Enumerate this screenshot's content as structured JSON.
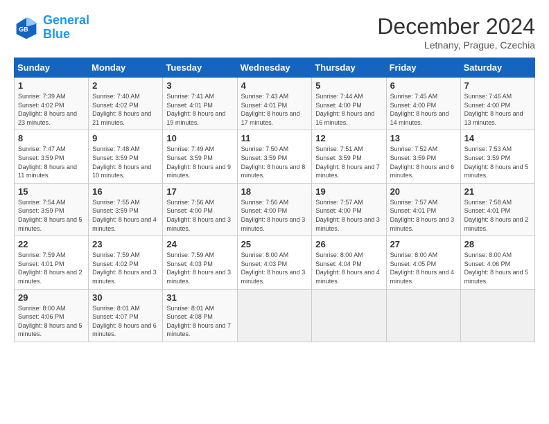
{
  "header": {
    "logo_line1": "General",
    "logo_line2": "Blue",
    "month": "December 2024",
    "location": "Letnany, Prague, Czechia"
  },
  "days_of_week": [
    "Sunday",
    "Monday",
    "Tuesday",
    "Wednesday",
    "Thursday",
    "Friday",
    "Saturday"
  ],
  "weeks": [
    [
      {
        "day": "1",
        "detail": "Sunrise: 7:39 AM\nSunset: 4:02 PM\nDaylight: 8 hours and 23 minutes."
      },
      {
        "day": "2",
        "detail": "Sunrise: 7:40 AM\nSunset: 4:02 PM\nDaylight: 8 hours and 21 minutes."
      },
      {
        "day": "3",
        "detail": "Sunrise: 7:41 AM\nSunset: 4:01 PM\nDaylight: 8 hours and 19 minutes."
      },
      {
        "day": "4",
        "detail": "Sunrise: 7:43 AM\nSunset: 4:01 PM\nDaylight: 8 hours and 17 minutes."
      },
      {
        "day": "5",
        "detail": "Sunrise: 7:44 AM\nSunset: 4:00 PM\nDaylight: 8 hours and 16 minutes."
      },
      {
        "day": "6",
        "detail": "Sunrise: 7:45 AM\nSunset: 4:00 PM\nDaylight: 8 hours and 14 minutes."
      },
      {
        "day": "7",
        "detail": "Sunrise: 7:46 AM\nSunset: 4:00 PM\nDaylight: 8 hours and 13 minutes."
      }
    ],
    [
      {
        "day": "8",
        "detail": "Sunrise: 7:47 AM\nSunset: 3:59 PM\nDaylight: 8 hours and 11 minutes."
      },
      {
        "day": "9",
        "detail": "Sunrise: 7:48 AM\nSunset: 3:59 PM\nDaylight: 8 hours and 10 minutes."
      },
      {
        "day": "10",
        "detail": "Sunrise: 7:49 AM\nSunset: 3:59 PM\nDaylight: 8 hours and 9 minutes."
      },
      {
        "day": "11",
        "detail": "Sunrise: 7:50 AM\nSunset: 3:59 PM\nDaylight: 8 hours and 8 minutes."
      },
      {
        "day": "12",
        "detail": "Sunrise: 7:51 AM\nSunset: 3:59 PM\nDaylight: 8 hours and 7 minutes."
      },
      {
        "day": "13",
        "detail": "Sunrise: 7:52 AM\nSunset: 3:59 PM\nDaylight: 8 hours and 6 minutes."
      },
      {
        "day": "14",
        "detail": "Sunrise: 7:53 AM\nSunset: 3:59 PM\nDaylight: 8 hours and 5 minutes."
      }
    ],
    [
      {
        "day": "15",
        "detail": "Sunrise: 7:54 AM\nSunset: 3:59 PM\nDaylight: 8 hours and 5 minutes."
      },
      {
        "day": "16",
        "detail": "Sunrise: 7:55 AM\nSunset: 3:59 PM\nDaylight: 8 hours and 4 minutes."
      },
      {
        "day": "17",
        "detail": "Sunrise: 7:56 AM\nSunset: 4:00 PM\nDaylight: 8 hours and 3 minutes."
      },
      {
        "day": "18",
        "detail": "Sunrise: 7:56 AM\nSunset: 4:00 PM\nDaylight: 8 hours and 3 minutes."
      },
      {
        "day": "19",
        "detail": "Sunrise: 7:57 AM\nSunset: 4:00 PM\nDaylight: 8 hours and 3 minutes."
      },
      {
        "day": "20",
        "detail": "Sunrise: 7:57 AM\nSunset: 4:01 PM\nDaylight: 8 hours and 3 minutes."
      },
      {
        "day": "21",
        "detail": "Sunrise: 7:58 AM\nSunset: 4:01 PM\nDaylight: 8 hours and 2 minutes."
      }
    ],
    [
      {
        "day": "22",
        "detail": "Sunrise: 7:59 AM\nSunset: 4:01 PM\nDaylight: 8 hours and 2 minutes."
      },
      {
        "day": "23",
        "detail": "Sunrise: 7:59 AM\nSunset: 4:02 PM\nDaylight: 8 hours and 3 minutes."
      },
      {
        "day": "24",
        "detail": "Sunrise: 7:59 AM\nSunset: 4:03 PM\nDaylight: 8 hours and 3 minutes."
      },
      {
        "day": "25",
        "detail": "Sunrise: 8:00 AM\nSunset: 4:03 PM\nDaylight: 8 hours and 3 minutes."
      },
      {
        "day": "26",
        "detail": "Sunrise: 8:00 AM\nSunset: 4:04 PM\nDaylight: 8 hours and 4 minutes."
      },
      {
        "day": "27",
        "detail": "Sunrise: 8:00 AM\nSunset: 4:05 PM\nDaylight: 8 hours and 4 minutes."
      },
      {
        "day": "28",
        "detail": "Sunrise: 8:00 AM\nSunset: 4:06 PM\nDaylight: 8 hours and 5 minutes."
      }
    ],
    [
      {
        "day": "29",
        "detail": "Sunrise: 8:00 AM\nSunset: 4:06 PM\nDaylight: 8 hours and 5 minutes."
      },
      {
        "day": "30",
        "detail": "Sunrise: 8:01 AM\nSunset: 4:07 PM\nDaylight: 8 hours and 6 minutes."
      },
      {
        "day": "31",
        "detail": "Sunrise: 8:01 AM\nSunset: 4:08 PM\nDaylight: 8 hours and 7 minutes."
      },
      {
        "day": "",
        "detail": ""
      },
      {
        "day": "",
        "detail": ""
      },
      {
        "day": "",
        "detail": ""
      },
      {
        "day": "",
        "detail": ""
      }
    ]
  ]
}
